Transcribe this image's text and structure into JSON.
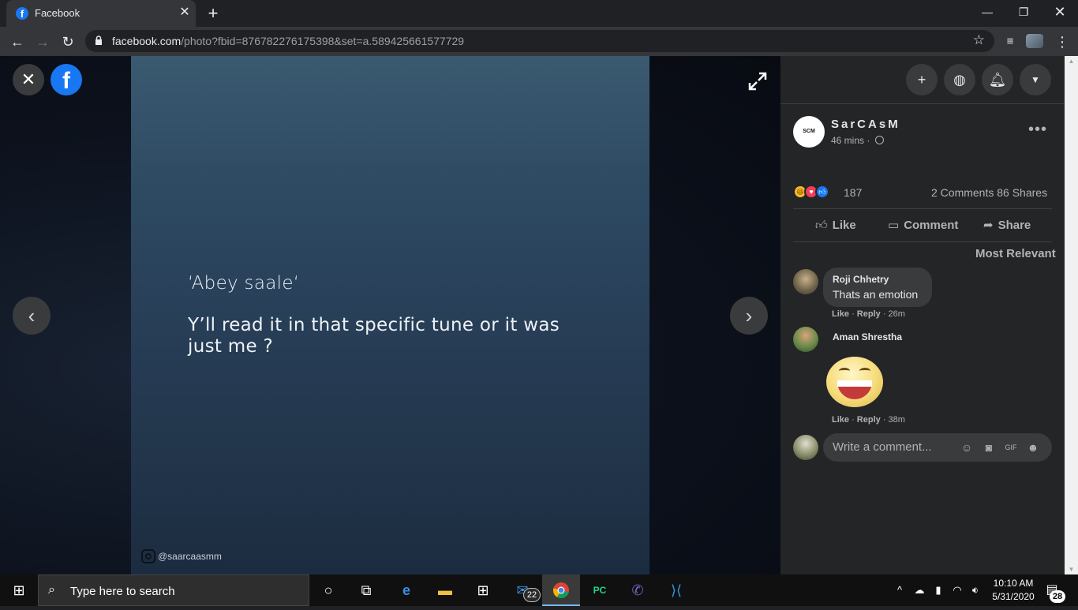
{
  "browser": {
    "tab_title": "Facebook",
    "tab_favicon": "f",
    "url_host": "facebook.com",
    "url_path": "/photo?fbid=876782276175398&set=a.589425661577729"
  },
  "viewer": {
    "close_icon": "✕",
    "fb_logo": "f",
    "photo_line1": "‘Abey saale‘",
    "photo_line2": "Y’ll read it in that specific tune or it was just me ?",
    "ig_handle": "@saarcaasmm",
    "prev_glyph": "‹",
    "next_glyph": "›"
  },
  "post": {
    "page_avatar_text": "SCM",
    "page_name": "SarCAsM",
    "time": "46 mins ·",
    "reaction_count": "187",
    "comments_shares": "2 Comments  86 Shares",
    "actions": {
      "like": "Like",
      "comment": "Comment",
      "share": "Share"
    },
    "sort_label": "Most Relevant",
    "reaction_icons": [
      "haha-icon",
      "love-icon",
      "like-icon"
    ]
  },
  "comments": [
    {
      "name": "Roji Chhetry",
      "text": "Thats an emotion",
      "like": "Like",
      "reply": "Reply",
      "time": "26m"
    },
    {
      "name": "Aman Shrestha",
      "text": "",
      "like": "Like",
      "reply": "Reply",
      "time": "38m"
    }
  ],
  "composer": {
    "placeholder": "Write a comment..."
  },
  "taskbar": {
    "search_placeholder": "Type here to search",
    "mail_badge": "22",
    "time": "10:10 AM",
    "date": "5/31/2020",
    "notif_count": "28"
  },
  "colors": {
    "fb_blue": "#1877f2",
    "panel_bg": "#242526",
    "bubble_bg": "#3a3b3c"
  }
}
